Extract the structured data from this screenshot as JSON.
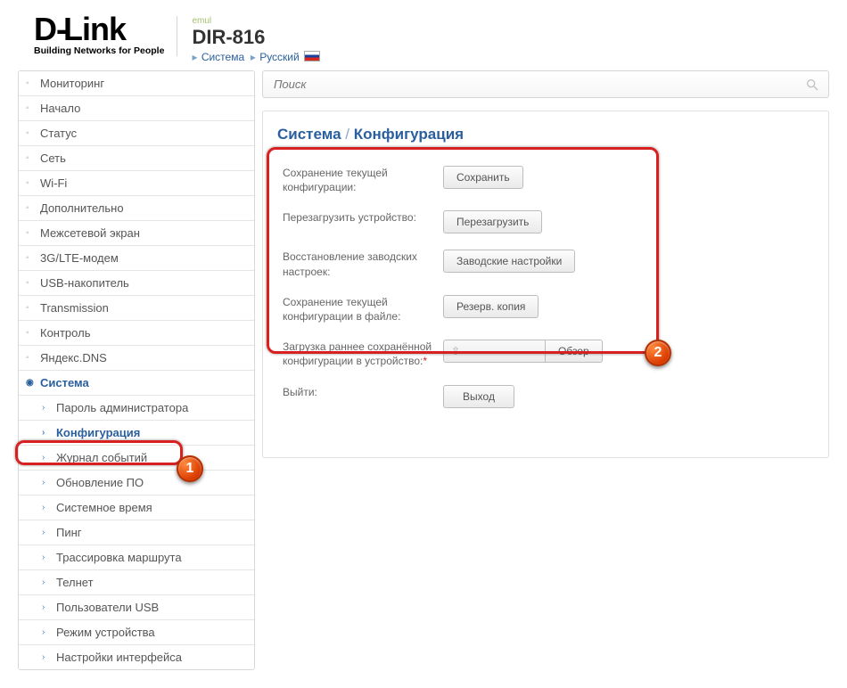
{
  "header": {
    "logo_brand": "D-Link",
    "logo_tag": "Building Networks for People",
    "emul": "emul",
    "model": "DIR-816",
    "crumb_system": "Система",
    "crumb_lang": "Русский"
  },
  "search": {
    "placeholder": "Поиск"
  },
  "sidebar": {
    "items": [
      {
        "label": "Мониторинг"
      },
      {
        "label": "Начало"
      },
      {
        "label": "Статус"
      },
      {
        "label": "Сеть"
      },
      {
        "label": "Wi-Fi"
      },
      {
        "label": "Дополнительно"
      },
      {
        "label": "Межсетевой экран"
      },
      {
        "label": "3G/LTE-модем"
      },
      {
        "label": "USB-накопитель"
      },
      {
        "label": "Transmission"
      },
      {
        "label": "Контроль"
      },
      {
        "label": "Яндекс.DNS"
      }
    ],
    "system_label": "Система",
    "subitems": [
      {
        "label": "Пароль администратора"
      },
      {
        "label": "Конфигурация"
      },
      {
        "label": "Журнал событий"
      },
      {
        "label": "Обновление ПО"
      },
      {
        "label": "Системное время"
      },
      {
        "label": "Пинг"
      },
      {
        "label": "Трассировка маршрута"
      },
      {
        "label": "Телнет"
      },
      {
        "label": "Пользователи USB"
      },
      {
        "label": "Режим устройства"
      },
      {
        "label": "Настройки интерфейса"
      }
    ]
  },
  "main": {
    "breadcrumb_a": "Система",
    "breadcrumb_b": "Конфигурация",
    "rows": [
      {
        "label": "Сохранение текущей конфигурации:",
        "button": "Сохранить"
      },
      {
        "label": "Перезагрузить устройство:",
        "button": "Перезагрузить"
      },
      {
        "label": "Восстановление заводских настроек:",
        "button": "Заводские настройки"
      },
      {
        "label": "Сохранение текущей конфигурации в файле:",
        "button": "Резерв. копия"
      }
    ],
    "file_label": "Загрузка раннее сохранённой конфигурации в устройство:",
    "browse": "Обзор",
    "upload_icon": "⇧",
    "exit_label": "Выйти:",
    "exit_button": "Выход"
  },
  "badges": {
    "one": "1",
    "two": "2"
  }
}
